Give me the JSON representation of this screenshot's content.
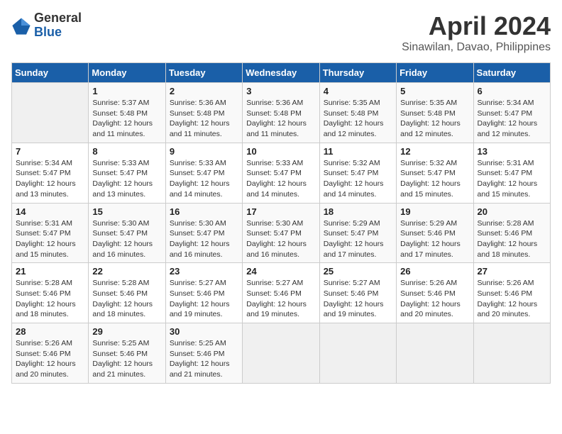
{
  "header": {
    "logo_general": "General",
    "logo_blue": "Blue",
    "month_title": "April 2024",
    "location": "Sinawilan, Davao, Philippines"
  },
  "days_of_week": [
    "Sunday",
    "Monday",
    "Tuesday",
    "Wednesday",
    "Thursday",
    "Friday",
    "Saturday"
  ],
  "weeks": [
    [
      {
        "day": "",
        "info": ""
      },
      {
        "day": "1",
        "info": "Sunrise: 5:37 AM\nSunset: 5:48 PM\nDaylight: 12 hours\nand 11 minutes."
      },
      {
        "day": "2",
        "info": "Sunrise: 5:36 AM\nSunset: 5:48 PM\nDaylight: 12 hours\nand 11 minutes."
      },
      {
        "day": "3",
        "info": "Sunrise: 5:36 AM\nSunset: 5:48 PM\nDaylight: 12 hours\nand 11 minutes."
      },
      {
        "day": "4",
        "info": "Sunrise: 5:35 AM\nSunset: 5:48 PM\nDaylight: 12 hours\nand 12 minutes."
      },
      {
        "day": "5",
        "info": "Sunrise: 5:35 AM\nSunset: 5:48 PM\nDaylight: 12 hours\nand 12 minutes."
      },
      {
        "day": "6",
        "info": "Sunrise: 5:34 AM\nSunset: 5:47 PM\nDaylight: 12 hours\nand 12 minutes."
      }
    ],
    [
      {
        "day": "7",
        "info": "Sunrise: 5:34 AM\nSunset: 5:47 PM\nDaylight: 12 hours\nand 13 minutes."
      },
      {
        "day": "8",
        "info": "Sunrise: 5:33 AM\nSunset: 5:47 PM\nDaylight: 12 hours\nand 13 minutes."
      },
      {
        "day": "9",
        "info": "Sunrise: 5:33 AM\nSunset: 5:47 PM\nDaylight: 12 hours\nand 14 minutes."
      },
      {
        "day": "10",
        "info": "Sunrise: 5:33 AM\nSunset: 5:47 PM\nDaylight: 12 hours\nand 14 minutes."
      },
      {
        "day": "11",
        "info": "Sunrise: 5:32 AM\nSunset: 5:47 PM\nDaylight: 12 hours\nand 14 minutes."
      },
      {
        "day": "12",
        "info": "Sunrise: 5:32 AM\nSunset: 5:47 PM\nDaylight: 12 hours\nand 15 minutes."
      },
      {
        "day": "13",
        "info": "Sunrise: 5:31 AM\nSunset: 5:47 PM\nDaylight: 12 hours\nand 15 minutes."
      }
    ],
    [
      {
        "day": "14",
        "info": "Sunrise: 5:31 AM\nSunset: 5:47 PM\nDaylight: 12 hours\nand 15 minutes."
      },
      {
        "day": "15",
        "info": "Sunrise: 5:30 AM\nSunset: 5:47 PM\nDaylight: 12 hours\nand 16 minutes."
      },
      {
        "day": "16",
        "info": "Sunrise: 5:30 AM\nSunset: 5:47 PM\nDaylight: 12 hours\nand 16 minutes."
      },
      {
        "day": "17",
        "info": "Sunrise: 5:30 AM\nSunset: 5:47 PM\nDaylight: 12 hours\nand 16 minutes."
      },
      {
        "day": "18",
        "info": "Sunrise: 5:29 AM\nSunset: 5:47 PM\nDaylight: 12 hours\nand 17 minutes."
      },
      {
        "day": "19",
        "info": "Sunrise: 5:29 AM\nSunset: 5:46 PM\nDaylight: 12 hours\nand 17 minutes."
      },
      {
        "day": "20",
        "info": "Sunrise: 5:28 AM\nSunset: 5:46 PM\nDaylight: 12 hours\nand 18 minutes."
      }
    ],
    [
      {
        "day": "21",
        "info": "Sunrise: 5:28 AM\nSunset: 5:46 PM\nDaylight: 12 hours\nand 18 minutes."
      },
      {
        "day": "22",
        "info": "Sunrise: 5:28 AM\nSunset: 5:46 PM\nDaylight: 12 hours\nand 18 minutes."
      },
      {
        "day": "23",
        "info": "Sunrise: 5:27 AM\nSunset: 5:46 PM\nDaylight: 12 hours\nand 19 minutes."
      },
      {
        "day": "24",
        "info": "Sunrise: 5:27 AM\nSunset: 5:46 PM\nDaylight: 12 hours\nand 19 minutes."
      },
      {
        "day": "25",
        "info": "Sunrise: 5:27 AM\nSunset: 5:46 PM\nDaylight: 12 hours\nand 19 minutes."
      },
      {
        "day": "26",
        "info": "Sunrise: 5:26 AM\nSunset: 5:46 PM\nDaylight: 12 hours\nand 20 minutes."
      },
      {
        "day": "27",
        "info": "Sunrise: 5:26 AM\nSunset: 5:46 PM\nDaylight: 12 hours\nand 20 minutes."
      }
    ],
    [
      {
        "day": "28",
        "info": "Sunrise: 5:26 AM\nSunset: 5:46 PM\nDaylight: 12 hours\nand 20 minutes."
      },
      {
        "day": "29",
        "info": "Sunrise: 5:25 AM\nSunset: 5:46 PM\nDaylight: 12 hours\nand 21 minutes."
      },
      {
        "day": "30",
        "info": "Sunrise: 5:25 AM\nSunset: 5:46 PM\nDaylight: 12 hours\nand 21 minutes."
      },
      {
        "day": "",
        "info": ""
      },
      {
        "day": "",
        "info": ""
      },
      {
        "day": "",
        "info": ""
      },
      {
        "day": "",
        "info": ""
      }
    ]
  ]
}
